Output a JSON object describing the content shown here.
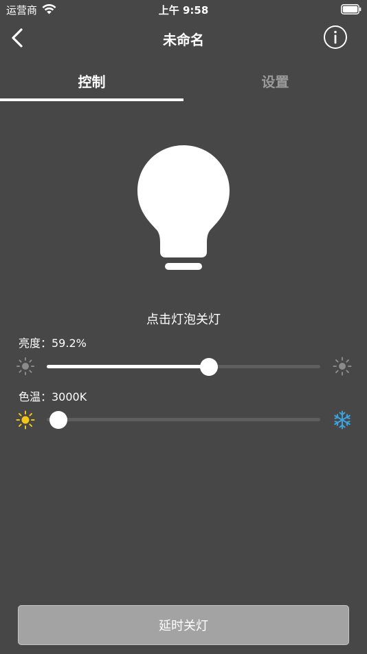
{
  "status_bar": {
    "carrier": "运营商",
    "time": "上午 9:58"
  },
  "nav": {
    "title": "未命名",
    "back_icon": "chevron-left-icon",
    "info_icon": "info-circle-icon"
  },
  "tabs": [
    {
      "label": "控制",
      "active": true
    },
    {
      "label": "设置",
      "active": false
    }
  ],
  "bulb": {
    "hint": "点击灯泡关灯",
    "icon": "light-bulb-icon"
  },
  "brightness": {
    "label": "亮度：59.2%",
    "value_percent": 59.2,
    "min_icon": "sun-dim-icon",
    "max_icon": "sun-bright-icon"
  },
  "color_temperature": {
    "label": "色温：3000K",
    "value_fraction": 0.02,
    "warm_icon": "sun-icon",
    "cool_icon": "snowflake-icon",
    "warm_color": "#f5c518",
    "cool_color": "#3ba3e0"
  },
  "delay_button": {
    "label": "延时关灯"
  },
  "colors": {
    "background": "#474747",
    "tab_active": "#ffffff",
    "tab_inactive": "#9a9a9a",
    "button_bg": "#a3a3a3"
  }
}
